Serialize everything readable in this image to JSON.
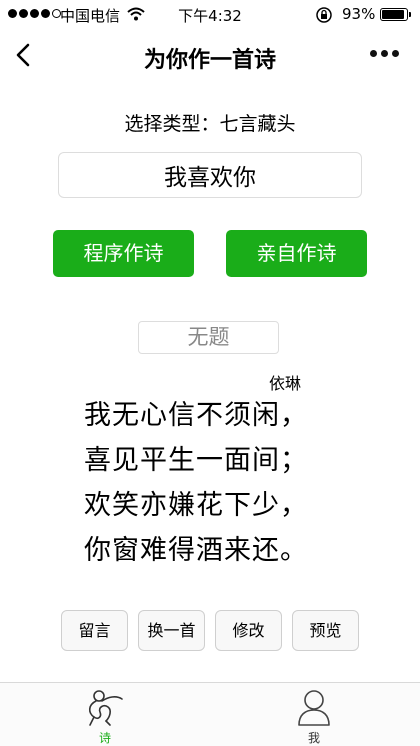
{
  "status_bar": {
    "carrier": "中国电信",
    "time": "下午4:32",
    "battery": "93%",
    "battery_level": 0.93
  },
  "nav": {
    "title": "为你作一首诗"
  },
  "form": {
    "type_label": "选择类型：七言藏头",
    "head_input_value": "我喜欢你",
    "auto_button": "程序作诗",
    "self_button": "亲自作诗"
  },
  "poem": {
    "title_placeholder": "无题",
    "author": "依琳",
    "lines": [
      "我无心信不须闲，",
      "喜见平生一面间；",
      "欢笑亦嫌花下少，",
      "你窗难得酒来还。"
    ]
  },
  "actions": {
    "comment": "留言",
    "change": "换一首",
    "edit": "修改",
    "preview": "预览"
  },
  "tabbar": {
    "poem": "诗",
    "me": "我",
    "active_color": "#1aad19"
  },
  "colors": {
    "accent": "#1aad19"
  }
}
